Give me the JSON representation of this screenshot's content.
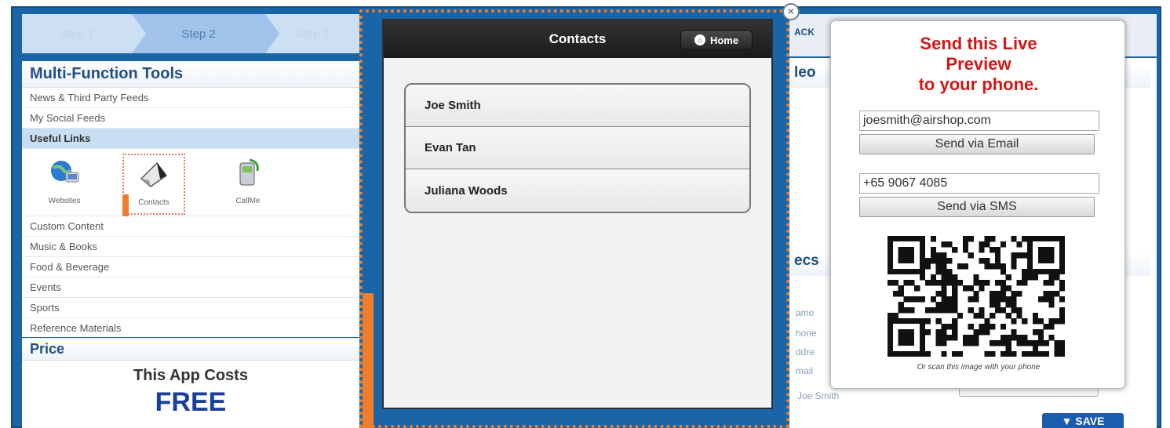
{
  "steps": {
    "step1": "Step 1",
    "step2": "Step 2",
    "step3": "Step 3"
  },
  "tools": {
    "title": "Multi-Function Tools",
    "rows_top": [
      "News & Third Party Feeds",
      "My Social Feeds",
      "Useful Links"
    ],
    "tiles": [
      {
        "label": "Websites",
        "icon": "globe-icon"
      },
      {
        "label": "Contacts",
        "icon": "contacts-icon"
      },
      {
        "label": "CallMe",
        "icon": "phone-icon"
      }
    ],
    "rows_bottom": [
      "Custom Content",
      "Music & Books",
      "Food & Beverage",
      "Events",
      "Sports",
      "Reference Materials"
    ]
  },
  "price": {
    "title": "Price",
    "line1": "This App Costs",
    "line2": "FREE"
  },
  "phone": {
    "title": "Contacts",
    "home_label": "Home",
    "contacts": [
      "Joe Smith",
      "Evan Tan",
      "Juliana Woods"
    ]
  },
  "right": {
    "back_label": "ACK",
    "head1": "leo",
    "head2": "ecs",
    "faint_labels": [
      "ame",
      "hone",
      "ddre",
      "mail",
      "Joe Smith"
    ],
    "save_label": "SAVE"
  },
  "popup": {
    "title_line1": "Send this Live",
    "title_line2": "Preview",
    "title_line3": "to your phone.",
    "email_value": "joesmith@airshop.com",
    "email_button": "Send via Email",
    "phone_value": "+65 9067 4085",
    "sms_button": "Send via SMS",
    "qr_note": "Or scan this image with your phone"
  },
  "colors": {
    "accent_blue": "#1a64a8",
    "popup_title": "#d41616",
    "selection_orange": "#f07d2a"
  }
}
